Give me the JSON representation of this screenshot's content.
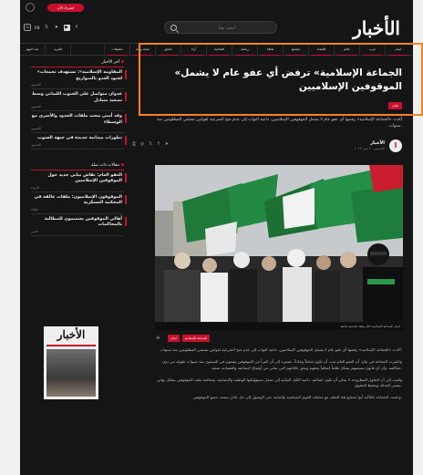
{
  "topbar": {
    "subscribe_label": "اشترك الآن",
    "lang": "EN"
  },
  "header": {
    "logo": "الأخبار",
    "search_placeholder": "ابحث هنا"
  },
  "nav": {
    "items": [
      "لبنان",
      "عرب",
      "عالم",
      "اقتصاد",
      "مجتمع",
      "ثقافة",
      "رياضة",
      "افتتاحية",
      "آراء",
      "ملحق",
      "صحة وبيئة",
      "تحقيقات"
    ],
    "left_items": [
      "عدد اليوم",
      "المزيد"
    ]
  },
  "sidebar": {
    "latest_title": "آخر الأخبار",
    "latest": [
      {
        "title": "«المقاومة الإسلامية»: نستهدف تجمعات لجنود العدو بالصواريخ",
        "date": "الخميس"
      },
      {
        "title": "عدوان متواصل على الجنوب اللبناني وسط تصعيد متبادل",
        "date": "الخميس"
      },
      {
        "title": "وفد أمني يبحث ملفات الحدود والأسرى مع الوسطاء",
        "date": "الخميس"
      },
      {
        "title": "تطورات ميدانية جديدة في جبهة الجنوب",
        "date": "الخميس"
      }
    ],
    "related_title": "مقالات ذات صلة",
    "related": [
      {
        "title": "العفو العام: نقاش نيابي جديد حول الموقوفين الإسلاميين",
        "date": "الأربعاء"
      },
      {
        "title": "الموقوفون الإسلاميون: ملفات عالقة في المحكمة العسكرية",
        "date": "الثلاثاء"
      },
      {
        "title": "أهالي الموقوفين يعتصمون للمطالبة بالمحاكمات",
        "date": "الاثنين"
      }
    ]
  },
  "article": {
    "title": "«الجماعة الإسلامية» ترفض أي عفو عام لا يشمل الموقوفين الإسلاميين",
    "category": "لبنان",
    "lead": "أكدت «الجماعة الإسلامية» رفضها أي عفو عام لا يشمل الموقوفين الإسلاميين، داعية النواب إلى عدم منح الشرعية لقوانين تستثني المظلومين منذ سنوات.",
    "author": "الأخبار",
    "date": "الخميس ٢٠ تموز ٢٠٢٣",
    "caption": "أنصار الجماعة الإسلامية خلال وقفة تضامنية سابقة",
    "tags": [
      "لبنان",
      "الجماعة الإسلامية"
    ],
    "paragraphs": [
      "أكدت «الجماعة الإسلامية» رفضها أي عفو عام لا يشمل الموقوفين الإسلاميين، داعية النواب إلى عدم منح الشرعية لقوانين تستثني المظلومين منذ سنوات.",
      "واعتبرت الجماعة في بيان، أن العفو العام يجب أن يكون شاملاً وعادلاً، مشيرة إلى أن كثيراً من الموقوفين يقبعون في السجون منذ سنوات طويلة من دون محاكمة، وأن أي قانون يستثنيهم يشكل ظلماً إضافياً بحقهم وبحق عائلاتهم التي تعاني من أوضاع اجتماعية واقتصادية صعبة.",
      "ولفتت إلى أن الحلول المطروحة لا يمكن أن تكون انتقائية، داعية الكتل النيابية إلى تحمل مسؤولياتها الوطنية والإنسانية، ومعالجة ملف الموقوفين بشكل نهائي يضمن العدالة ويحفظ الحقوق.",
      "وختمت الجماعة بالتأكيد أنها ستتابع هذا الملف مع مختلف القوى السياسية والنيابية حتى الوصول إلى حل عادل ينصف جميع الموقوفين."
    ]
  },
  "colors": {
    "accent": "#c8102e",
    "highlight": "#f58220",
    "background": "#151515"
  }
}
